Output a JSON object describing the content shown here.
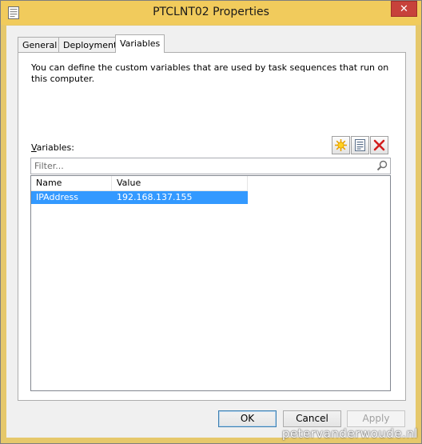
{
  "window": {
    "title": "PTCLNT02 Properties",
    "close_label": "✕"
  },
  "tabs": [
    {
      "label": "General"
    },
    {
      "label": "Deployments"
    },
    {
      "label": "Variables"
    }
  ],
  "active_tab": "Variables",
  "variables_tab": {
    "description": "You can define the custom variables that are used by task sequences that run on this computer.",
    "variables_label_underlined": "V",
    "variables_label_rest": "ariables:",
    "filter": {
      "placeholder": "Filter...",
      "value": ""
    },
    "toolbar_icons": [
      "new-icon",
      "properties-icon",
      "delete-icon"
    ],
    "table": {
      "columns": [
        "Name",
        "Value"
      ],
      "rows": [
        {
          "name": "IPAddress",
          "value": "192.168.137.155",
          "selected": true
        }
      ]
    }
  },
  "buttons": {
    "ok": "OK",
    "cancel": "Cancel",
    "apply": "Apply"
  },
  "watermark": "petervanderwoude.nl",
  "colors": {
    "title_bar": "#f1cb5c",
    "close_button": "#c7423b",
    "selection": "#3399ff"
  }
}
